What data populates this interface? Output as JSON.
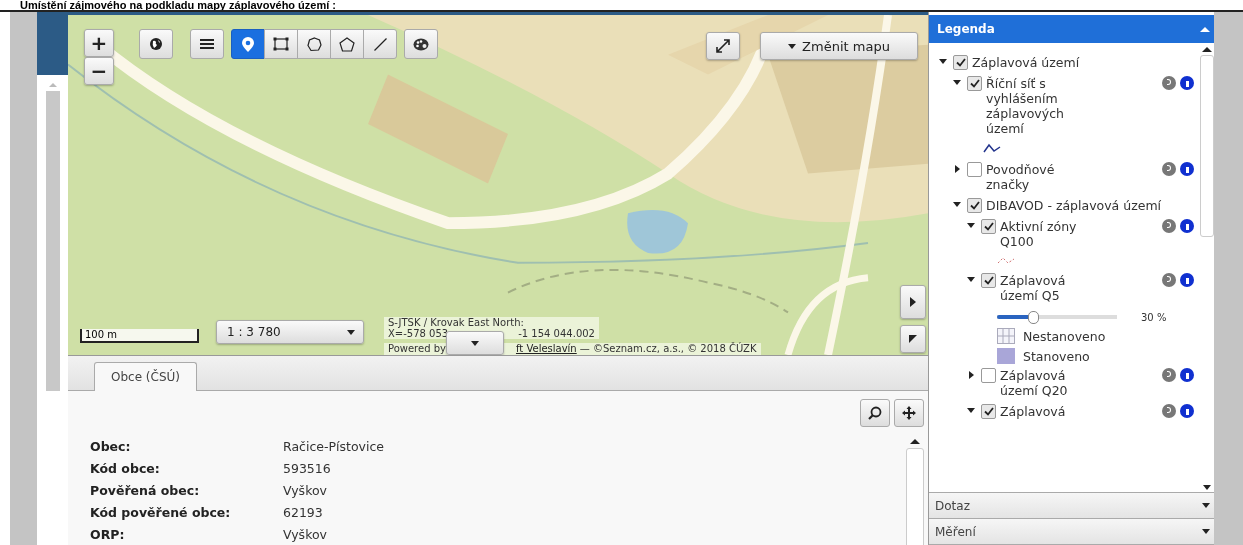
{
  "heading": "Umístění zájmového na podkladu mapy záplavového území :",
  "map": {
    "zoom_in": "+",
    "zoom_out": "−",
    "tools": [
      {
        "kind": "globe",
        "selected": false
      },
      {
        "kind": "menu",
        "selected": false
      },
      {
        "kind": "point",
        "selected": true
      },
      {
        "kind": "rectangle",
        "selected": false
      },
      {
        "kind": "circle",
        "selected": false
      },
      {
        "kind": "polygon",
        "selected": false
      },
      {
        "kind": "line",
        "selected": false
      },
      {
        "kind": "palette",
        "selected": false
      }
    ],
    "change_map": "Změnit mapu",
    "scale_bar": "100 m",
    "scale_select": "1 : 3 780",
    "coords_title": "S-JTSK / Krovak East North:",
    "coords_x": "X=-578 053",
    "coords_y": "-1 154 044.002",
    "attribution_prefix": "Powered by",
    "attribution_link": "ft Veleslavín",
    "attribution_rest": "— ©Seznam.cz, a.s., © 2018 ČÚZK"
  },
  "tabs": [
    {
      "label": "Obce (ČSÚ)",
      "selected": true
    }
  ],
  "details": [
    {
      "label": "Obec:",
      "value": "Račice-Pístovice"
    },
    {
      "label": "Kód obce:",
      "value": "593516"
    },
    {
      "label": "Pověřená obec:",
      "value": "Vyškov"
    },
    {
      "label": "Kód pověřené obce:",
      "value": "62193"
    },
    {
      "label": "ORP:",
      "value": "Vyškov"
    }
  ],
  "legend": {
    "title": "Legenda",
    "items": [
      {
        "label": "Záplavová území",
        "checked": true,
        "expanded": true,
        "info": false,
        "children": [
          {
            "label": "Říční síť s vyhlášením záplavových území",
            "checked": true,
            "expanded": true,
            "info": true,
            "symbol": {
              "kind": "line"
            }
          },
          {
            "label": "Povodňové značky",
            "checked": false,
            "expanded": false,
            "info": true
          },
          {
            "label": "DIBAVOD - záplavová území",
            "checked": true,
            "expanded": true,
            "info": false,
            "children": [
              {
                "label": "Aktivní zóny Q100",
                "checked": true,
                "expanded": true,
                "info": true,
                "symbol": {
                  "kind": "dashed"
                }
              },
              {
                "label": "Záplavová území Q5",
                "checked": true,
                "expanded": true,
                "info": true,
                "opacity": {
                  "level": 0.3,
                  "reading": "30 %"
                },
                "classes": [
                  {
                    "label": "Nestanoveno",
                    "kind": "hatch"
                  },
                  {
                    "label": "Stanoveno",
                    "kind": "fill"
                  }
                ]
              },
              {
                "label": "Záplavová území Q20",
                "checked": false,
                "expanded": false,
                "info": true
              },
              {
                "label": "Záplavová",
                "checked": true,
                "expanded": true,
                "info": true
              }
            ]
          }
        ]
      }
    ]
  },
  "sections": [
    {
      "label": "Dotaz"
    },
    {
      "label": "Měření"
    }
  ]
}
